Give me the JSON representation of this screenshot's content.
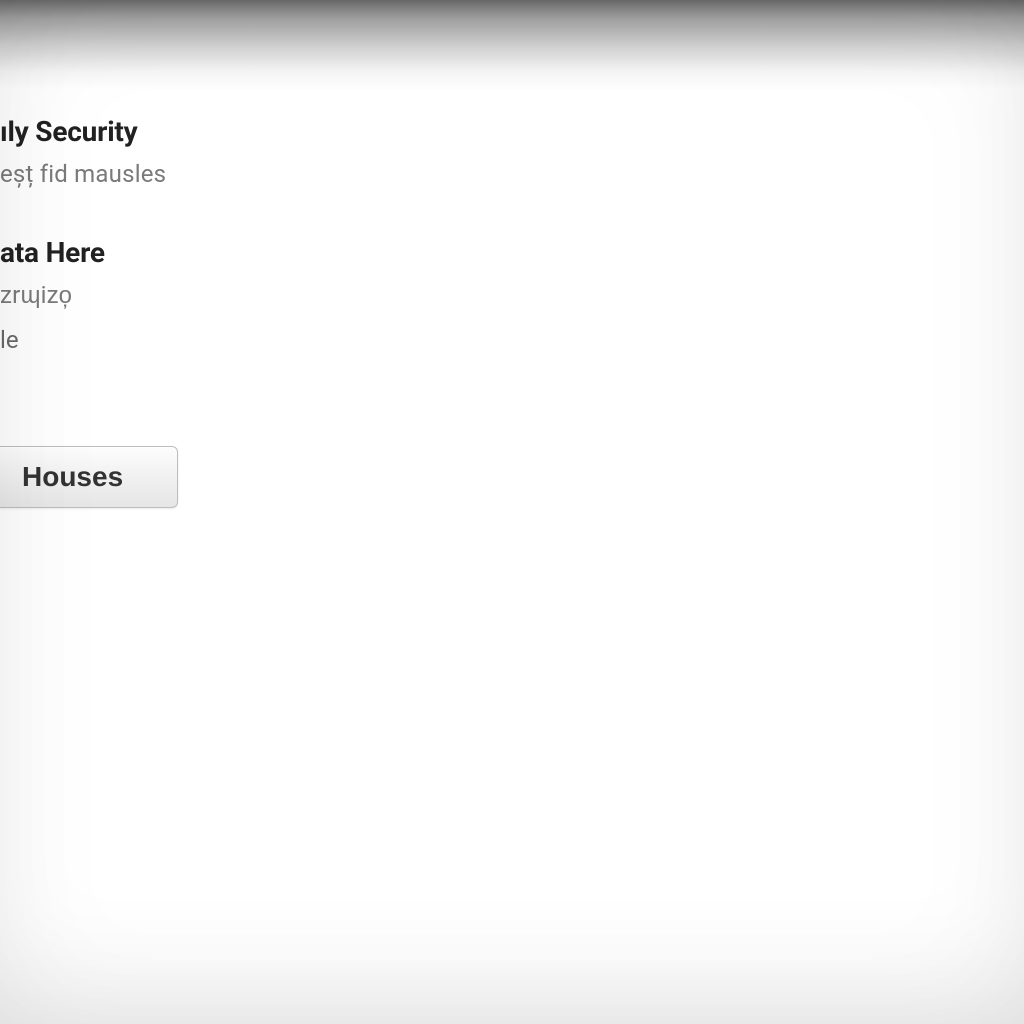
{
  "sections": [
    {
      "title": "ıly Security",
      "sub": "eșț fid mausles"
    },
    {
      "title": "ata Here",
      "sub": "zrɰizo̦",
      "sub2": "le"
    }
  ],
  "button": {
    "label": "Houses"
  }
}
